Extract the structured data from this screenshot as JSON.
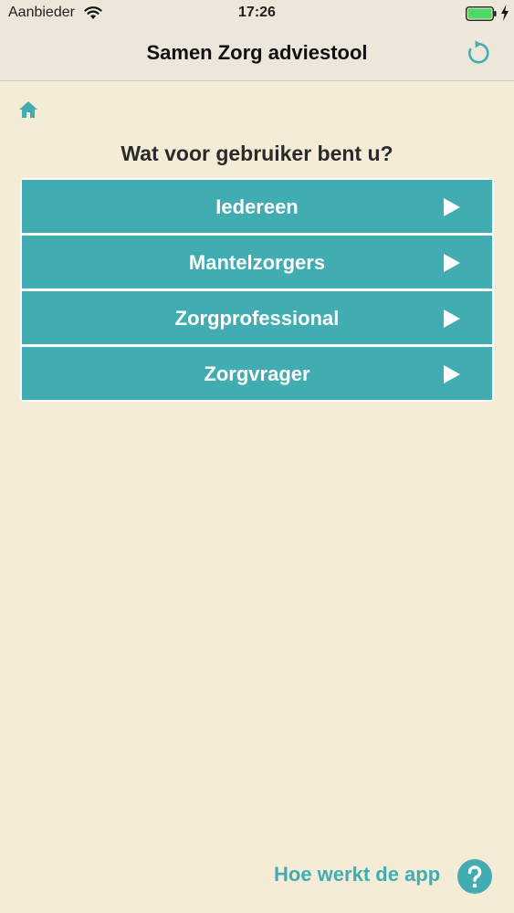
{
  "status_bar": {
    "carrier": "Aanbieder",
    "time": "17:26",
    "wifi_icon": "wifi-icon",
    "battery_icon": "battery-full-icon",
    "charging_icon": "bolt-icon",
    "battery_color": "#4cd964"
  },
  "nav": {
    "title": "Samen Zorg adviestool",
    "refresh_icon": "refresh-icon"
  },
  "breadcrumb": {
    "home_icon": "home-icon"
  },
  "main": {
    "question": "Wat voor gebruiker bent u?",
    "options": [
      {
        "label": "Iedereen",
        "icon": "play-arrow-icon"
      },
      {
        "label": "Mantelzorgers",
        "icon": "play-arrow-icon"
      },
      {
        "label": "Zorgprofessional",
        "icon": "play-arrow-icon"
      },
      {
        "label": "Zorgvrager",
        "icon": "play-arrow-icon"
      }
    ]
  },
  "footer": {
    "help_label": "Hoe werkt de app",
    "help_icon": "question-icon"
  },
  "colors": {
    "background": "#f5ecd7",
    "bar": "#ece7da",
    "accent": "#41adb3",
    "button_text": "#ffffff"
  }
}
